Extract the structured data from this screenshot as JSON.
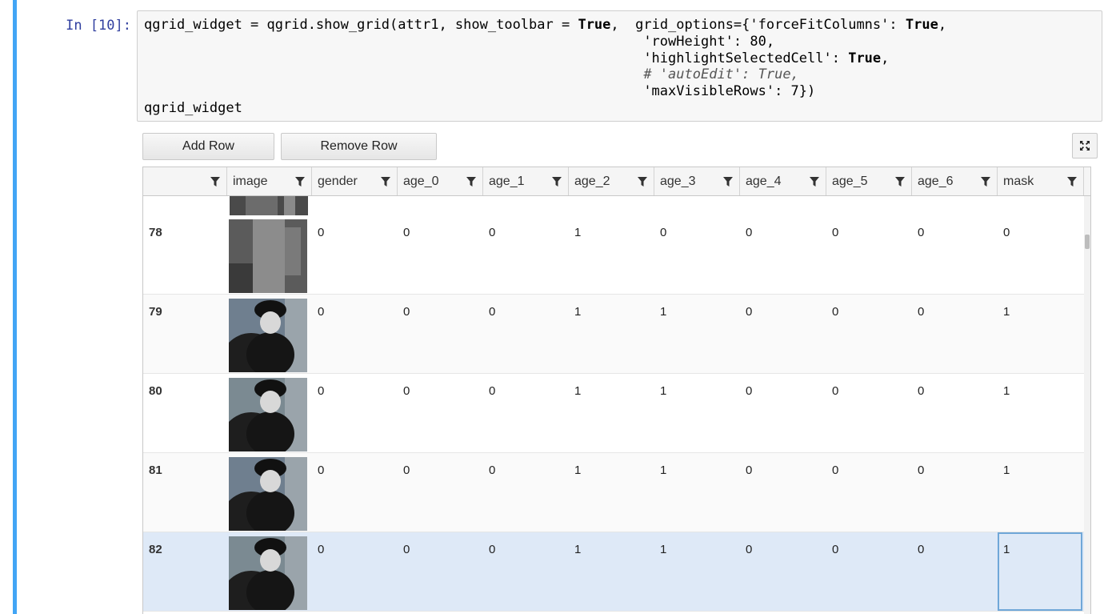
{
  "cell": {
    "prompt": "In [10]:",
    "code_lines": [
      [
        {
          "t": "qgrid_widget = qgrid.show_grid(attr1, show_toolbar = "
        },
        {
          "t": "True",
          "c": "kw"
        },
        {
          "t": ",  grid_options={'forceFitColumns': "
        },
        {
          "t": "True",
          "c": "kw"
        },
        {
          "t": ","
        }
      ],
      [
        {
          "t": "                                                             'rowHeight': 80,"
        }
      ],
      [
        {
          "t": "                                                             'highlightSelectedCell': "
        },
        {
          "t": "True",
          "c": "kw"
        },
        {
          "t": ","
        }
      ],
      [
        {
          "t": "                                                             "
        },
        {
          "t": "# 'autoEdit': True,",
          "c": "cm"
        }
      ],
      [
        {
          "t": "                                                             'maxVisibleRows': 7})"
        }
      ],
      [
        {
          "t": "qgrid_widget"
        }
      ]
    ]
  },
  "toolbar": {
    "add_row_label": "Add Row",
    "remove_row_label": "Remove Row",
    "fullscreen_icon": "expand-icon"
  },
  "grid": {
    "columns": [
      "",
      "image",
      "gender",
      "age_0",
      "age_1",
      "age_2",
      "age_3",
      "age_4",
      "age_5",
      "age_6",
      "mask"
    ],
    "rows": [
      {
        "index": "78",
        "values": [
          "0",
          "0",
          "0",
          "1",
          "0",
          "0",
          "0",
          "0",
          "0"
        ]
      },
      {
        "index": "79",
        "values": [
          "0",
          "0",
          "0",
          "1",
          "1",
          "0",
          "0",
          "0",
          "1"
        ]
      },
      {
        "index": "80",
        "values": [
          "0",
          "0",
          "0",
          "1",
          "1",
          "0",
          "0",
          "0",
          "1"
        ]
      },
      {
        "index": "81",
        "values": [
          "0",
          "0",
          "0",
          "1",
          "1",
          "0",
          "0",
          "0",
          "1"
        ]
      },
      {
        "index": "82",
        "values": [
          "0",
          "0",
          "0",
          "1",
          "1",
          "0",
          "0",
          "0",
          "1"
        ],
        "selected": true
      }
    ],
    "filter_icon": "filter-icon",
    "colors": {
      "accent": "#42a5f5",
      "selected_row": "#dee9f7",
      "focused_cell_border": "#6fa7d8"
    }
  }
}
